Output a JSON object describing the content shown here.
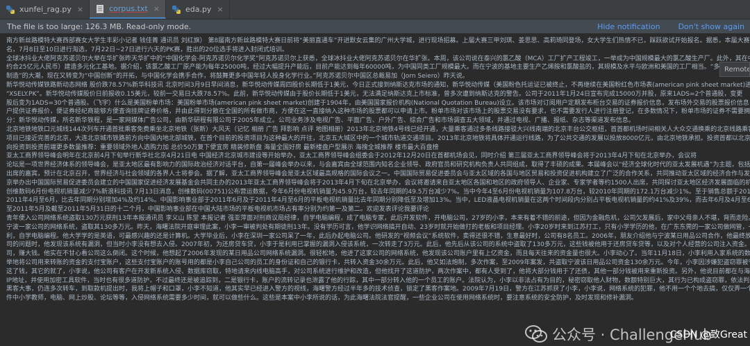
{
  "tabs": [
    {
      "name": "xunfei_rag.py",
      "icon": "python-file-icon",
      "active": false,
      "style": "normal"
    },
    {
      "name": "corpus.txt",
      "icon": "text-file-icon",
      "active": true,
      "style": "blue"
    },
    {
      "name": "eda.py",
      "icon": "python-file-icon",
      "active": false,
      "style": "normal"
    }
  ],
  "banner": {
    "message": "The file is too large: 126.3 MB. Read-only mode.",
    "hide_link": "Hide notification",
    "dont_show_link": "Don't show again"
  },
  "remote_label": "Remote",
  "editor_lines": [
    "南方新丝路模特大赛西部赛女大学生丰彩小记者 钱佳菁 通讯员 刘红旗） 第8届南方新丝路模特大赛日前将“美丽直通车”开进默女云集的广州大学城，进行现场招募。上届大赛三甲刘琪、姜思思、高莉琦同登场，女大学生们热情不已，踩跃欲试开始报名。据悉，本届大赛将于7月7日截止报名，",
    "名，7月8日至10日进行淘选，7月22日~27日进行六天的PK赛，胜出的20位选手将进入封闭式培训。",
    "全球冰抖业大佬阿克苏诺贝尔大举在华扩张昨天华扩中的“中国化学会-阿克苏诺贝尔化学奖”阿克苏诺贝尔上获悉，全球冰抖业大佬阿克苏诺贝尔在华扩张。本周，该公司说在泰兴的氯乙酸（MCA）工厂扩产工程竣工，一举成为中国规模最大的氯乙酸生产厂。此外，其在中宁波投资5.5亿欧元",
    "约合25亿元人民币）建造多元化工基地。据介绍，该氯乙酸工厂原产能为每年25000吨，经过大幅提升产能后，目前产能达到每年60000吨，为中国同类工厂规模最大。而在宁波的基地主要生产乙烯胺和氯酸盐的，其规模及水平与欧洲和美国的工厂相当。“多年前，我们积极参与",
    "制造”的大潮，现在又转变为“中国创新”的开拓，与中国化学会携手合作，将鼓舞更多中国年轻人投身化学行业。”阿克苏诺贝尔中国区总裁易加（Jorn Seiero）昨天说。",
    "新华悦动传媒铁路新动态网络 股价跌78.57%新华科技讯 北京时间3月9日早间消息，新华悦动传媒周四股价长期低于1美元，今日正式接到纳斯达克市场的通知，新华悦动传媒（美国粉色托运证已被终止，不再继续在美国粉红色市场表(american pink sheet market)进行交易。股票代码由“XSELD”变为",
    "“XSELY.PK”。新华悦动传媒股价日前报收0.15美元，较前一交易日大跌78.57%。此前，新华悦动传媒由于股价长期低于1美元，无法满足纳斯达克上市标准，曾多次遭到纳斯达克的警告。公司于2011年1月24日宣布完成15000万并股，原来1ADS=2个普通股，变更",
    "股后变为1ADS=30个普通股。（飞宇）什么是美国粉单市场：美国粉单市场(american pink sheet market)创建于1904年，由美国国家报价机构(National Quotation Bureau)设立。该市场对订阅用户定期发布柜台交易的证券报价信息，发布场外交易的股票报价信息，在每天交易结束后向所有的经纪商",
    "户提供证券报价，便证券经纪商能够方便查询挂牌证券价格，并由此得到分散在全国的所有做市商，方便在这一直接纳入这种市场的股票都可以申请上市。粉单市场对该市场上的股票交易没有要求，也不需要发行人进行注册登记，在多数情况下，粉单市场的证券不需要拥有交易所上市资格认证的股票，很难满足纽约",
    "分：新华悦动传媒，所名新华铁程，是一家网媒体广告公司，由新华研程有限公司于2005年成立。公司业务涉及电视广告、平面广告、户外广告、综合广告和市场调查五大领域，并通过电视、广播、报纸、杂志等渠道发布信息。",
    "北京地铁地铁口元城线144次列车开通首批乘客免费乘坐北京地铁（张新）大风天（记忆 相册 广告 拜影响 点评 地图相册）2013年北京地铁4号线已经开通，大量乘客通过多条线路接驳大兴线南端的北京丰台公交枢纽，首首都机场时间相关人大众交通换乘的北京线路乘客在首都机场线进行",
    "项目已接近完善的北京，大连北京城市铁路前方向中国内地北部城铁，在首个目前的投资项目为这种最大的开往，北京五大城区中的一个城市轨道交通项目。2013年北京地铁将具体开通运行线路，为了公共交通的发展以投放8000亿元，由北京地铁承担。投资首都以北京城市铁路作为其标志项目工程",
    "向投资到投资前端更多数量推荐：重要领域外地人选购力加 总价50万复下便宜房 精装修新盘 海量全国好房 最新楼盘户型展示 海搜全城推荐 楼市最大百盘榜",
    "亚太工商界领导峰会明年在北京前4月下旬举行新华社北京4月21日电 中国经济北京城市建设等开始举办，亚太工商界领导峰会组委会于2012年12月20日在首都机场会见，同时介绍 第三届亚太工商界领导峰会将于2013年4月下旬在北京举办，会议将",
    "论坛是一项世界经济体系的领导峰会，是亚太地区最有影响力的国际政治经济对话平台，自第一届峰会举办以来，与会嘉宾由全球范围内知名企业领导、政府官员和研究机构负责人共同组成，取得了丰硕的成果。本届峰会以“经济全球化时代的亚太发展机遇”为主题，包括欧洲、中东、南美洲、非洲",
    "出席的嘉宾，预计在北京召开，世界经济与社会领域的各界人士将参会。据了解，亚太工商界领导峰会是亚太区域最高规格的国际会议之一。中国国际贸易促进委员会与亚太区域的各国与地区贸易和投资促进机构建立了广泛的合作关系，共同推动亚太区域的经济合作与发展，亚太工商界领导峰会的举办将",
    "京举办出中国国际贸易促进委员会建立的中国国家促进经济发展基金会共同主办的2013年亚太工商界领导峰会将于2013年4月下旬在北京举办，会议将邀请来自亚太地区各国和地区的政府领导人、企业家、专家学者等约1500人出席，共同探讨亚太地区经济发展面临的机遇与挑战。",
    "创维数码6月份电视机销量减少7%新浪科技讯 7月13日消息，创维数码(00751)公布营运数据，今年6月份电视机销量为45.9万台，较去年同期的49.5万台减少7%。当中今年4至6月份电视机销量为107.8万台，较2010年同期的172.1万台减少1%。至于销售总额于2011年6月至",
    "2011年4月至6月，比去年同期分别增加4%及约14%。中国影响事业部于2011年6月及于2011年4月至6月的平板电视机销量比去年同期分别降低至及增加13%。当中，LED液晶电视机销量在这两个时间段内分别占平板电视机销量的约41%及39%，而去年6月及4月至6月分别占约25%及16%",
    "至2011年5月及截至2011年5月31日的十二个月，中国影响事业部在中国大陆市场的平板电视机市场占有率分别为约第一及第二。欢迎发表评论我要评论",
    "青年便入公司网络系统盗取130万元获刑13年本报通讯员 李义山 陈堂 本报记者 强亚萍面对刑商议局经律，自学电脑编程，成了电脑专家，此后开发软件，开电脑公司，27岁的小李，本来有着不错的前途，但因为金融危机，公司欠发展后，家中父母亲人不堪，背而走险。近日，由福州鼓楼",
    "宁波一家公司的网络系统，盗取其130多万元。昨天，海曙法院开庭审理此案，小李一审被判处有期徒刑13年。没有学历可言，他学识网络搞开自动、23岁时就开始做打的老板和项目经理。小李20岁时来到江苏打工，只有小学学历的他，在广东东莞的一家公司做网管，一边工作一边",
    "利，自学电脑编程。他大学学的是英语，可最感兴趣的还是计算机。大学毕业后，小李在深圳一家公司呆了一年，此后办起电脑公司。他研发的“视频会议”系统软件，卖得还很不错，生意最好时，公司有8名员工。2006年，朋友介绍他与宁波某日用品公司合作，他最终放弃了，在看起小李自己",
    "司的问题时，他发现该系统有漏洞，但当时小李没有想去入侵。2007年初，为还房贷车贷，小李于是利用已掌握的漏洞入侵该系统，一次转走了3万元。此后，他先后从该公司的系统中盗取了130多万元，这些钱被他用于还房贷车贷等，以及对个人经营的公司注入资金。小李被抓时，他的公司",
    "司，赚大钱。他实在不甘心看公司这么倒闭。这个时候，他想起了2006年发现的某日用品公司网络系统漏洞。很轻松地，他进了这家公司的网络系统，他发现该公司账户里有上亿资金，而且每天往来的资金量也很大。小李动心了。当年11月18日，小李利用入家系统的数据库漏洞，轻而易举",
    "举地将公司用来转账的资金的支付宝账户，这些支付宝账户的账号用的都是小李自己公司的员工的身份证和自己的银行卡，共转入资金30余万元。此后，他又如法炮制，多次作案，至2009年案发，共盗取宁波该日用品公司资金130余万元。今年，小李因涉嫌犯盗窃罪被宁波市公安局海曙分局",
    "这了钱，其它的就了，小李说，他公司有客户在开发新系统入侵、数据库窃取，特地请来内线电脑高手，对公司系统进行维护和改造，但他找开了这道防护，两次作案中，都有人受到了，他将大部分钱用于了还债，其他一部分钱被用来重新投资。另外，他说目前都在与海曙国家银行国外的",
    "IP地址，并使用加密工具软件，当时也有很多道防护，不过最终还是被追踪到，二是银行卡，账户的流转记录也泄露了他的行踪，其中一部分转入他的一个员工的账户。法院认为，小李以非法占有为目的，秘密窃取他人财物，数额特别巨大，其行为已构成盗窃罪，依法判处有期徒刑十三年，并处罚",
    "黑客大事，仍连多次转车，到取款机提出时，我将上帽子和口罩，小李不知道，他其实早已经进入警方的视线，海曙警方经过半年多的技术侦查，锁定了黑客作案地。2009年7月19日，警方在江苏抓获了小李，小李说，网络系统的犯罪，他不用一个个地去搞，仅仅弄一个系统就行了。",
    "件中小学教师，电脑、网上炒股、论坛等等，入侵网络系统需要多少时间，就可以做些什么。这些是本案中小李所说的话，为此海曙法院法官提醒，一些企业公司在使用网络系统时，要注意系统的安全防护，及时发现和修补漏洞。"
  ],
  "watermark": {
    "icon": "wechat-icon",
    "text": "公众号 · ChallengeHub"
  },
  "csdn_label": "CSDN @致Great"
}
